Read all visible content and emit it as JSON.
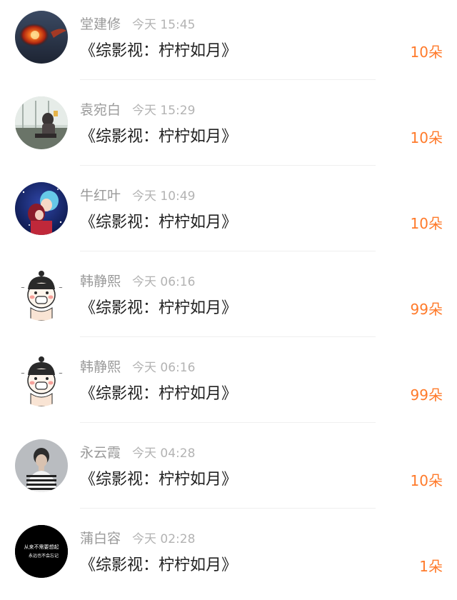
{
  "colors": {
    "amount": "#ff7a2a",
    "name": "#9a9a9a",
    "time": "#b3b3b3",
    "title": "#222222"
  },
  "gifts": [
    {
      "name": "堂建修",
      "time": "今天 15:45",
      "title": "《综影视：柠柠如月》",
      "amount": "10朵",
      "avatar_icon": "fireball-avatar"
    },
    {
      "name": "袁宛白",
      "time": "今天 15:29",
      "title": "《综影视：柠柠如月》",
      "amount": "10朵",
      "avatar_icon": "window-sitting-avatar"
    },
    {
      "name": "牛红叶",
      "time": "今天 10:49",
      "title": "《综影视：柠柠如月》",
      "amount": "10朵",
      "avatar_icon": "anime-couple-avatar"
    },
    {
      "name": "韩静熙",
      "time": "今天 06:16",
      "title": "《综影视：柠柠如月》",
      "amount": "99朵",
      "avatar_icon": "cartoon-girl-avatar"
    },
    {
      "name": "韩静熙",
      "time": "今天 06:16",
      "title": "《综影视：柠柠如月》",
      "amount": "99朵",
      "avatar_icon": "cartoon-girl-avatar"
    },
    {
      "name": "永云霞",
      "time": "今天 04:28",
      "title": "《综影视：柠柠如月》",
      "amount": "10朵",
      "avatar_icon": "striped-shirt-person-avatar"
    },
    {
      "name": "蒲白容",
      "time": "今天 02:28",
      "title": "《综影视：柠柠如月》",
      "amount": "1朵",
      "avatar_icon": "black-text-avatar"
    }
  ],
  "avatar_text": {
    "line1": "从来不需要想起",
    "line2": "永远也不会忘记"
  }
}
